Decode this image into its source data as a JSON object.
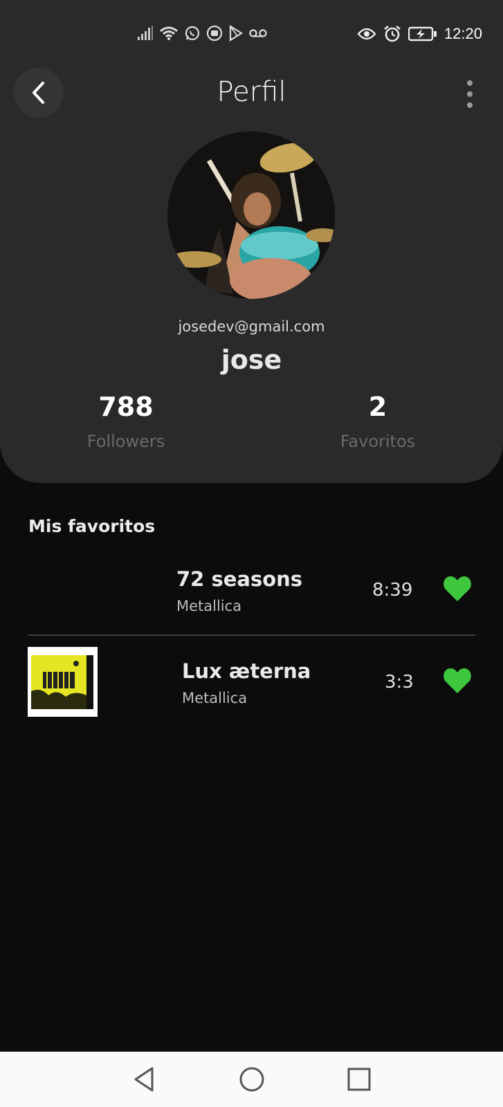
{
  "status_bar": {
    "time": "12:20",
    "left_icons": [
      "signal-icon",
      "wifi-icon",
      "whatsapp-icon",
      "media-icon",
      "play-store-icon",
      "voicemail-icon"
    ],
    "right_icons": [
      "eye-icon",
      "alarm-icon",
      "battery-icon"
    ]
  },
  "header": {
    "title": "Perfil",
    "back_icon": "chevron-left-icon",
    "menu_icon": "more-vertical-icon"
  },
  "profile": {
    "email": "josedev@gmail.com",
    "username": "jose",
    "followers_count": "788",
    "followers_label": "Followers",
    "favorites_count": "2",
    "favorites_label": "Favoritos"
  },
  "favorites_section": {
    "title": "Mis favoritos",
    "tracks": [
      {
        "title": "72 seasons",
        "artist": "Metallica",
        "duration": "8:39",
        "liked": true
      },
      {
        "title": "Lux æterna",
        "artist": "Metallica",
        "duration": "3:3",
        "liked": true
      }
    ]
  },
  "colors": {
    "background": "#0c0c0c",
    "card": "#2a2a2a",
    "heart": "#3ec73e",
    "nav_bar": "#fafafa"
  },
  "nav_bar": {
    "icons": [
      "back-triangle-icon",
      "home-circle-icon",
      "recents-square-icon"
    ]
  }
}
